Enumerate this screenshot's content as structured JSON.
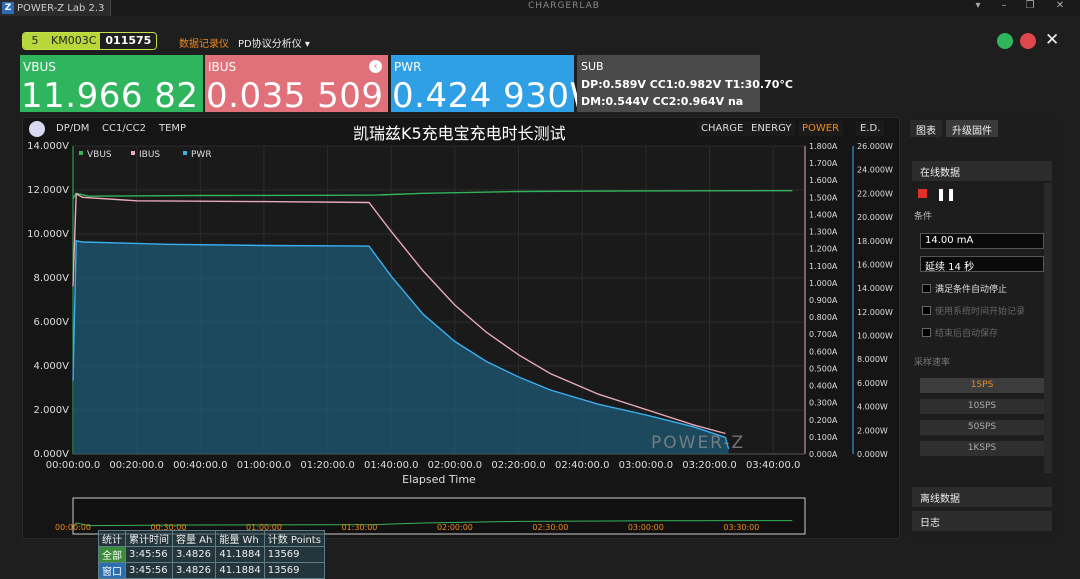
{
  "window": {
    "title": "POWER-Z Lab 2.3",
    "app_icon": "Z",
    "center_logo": "CHARGERLAB",
    "controls": [
      "menu-icon",
      "minimize-icon",
      "restore-icon",
      "close-icon"
    ]
  },
  "device": {
    "index": "5",
    "model": "KM003C",
    "serial": "011575"
  },
  "modes": {
    "recorder": "数据记录仪",
    "pd_analyzer": "PD协议分析仪"
  },
  "readouts": {
    "vbus": {
      "label": "VBUS",
      "value": "11.966 82 V",
      "color": "#2fb55d"
    },
    "ibus": {
      "label": "IBUS",
      "value": "0.035 509 A",
      "color": "#e0707a"
    },
    "pwr": {
      "label": "PWR",
      "value": "0.424 930W",
      "color": "#2f9fe6"
    },
    "sub": {
      "label": "SUB",
      "line1": "DP:0.589V  CC1:0.982V  T1:30.70°C",
      "line2": "DM:0.544V  CC2:0.964V  na"
    }
  },
  "chart_tabs_left": [
    "DP/DM",
    "CC1/CC2",
    "TEMP"
  ],
  "chart_tabs_right": [
    "CHARGE",
    "ENERGY",
    "POWER",
    "E.D."
  ],
  "chart_active_tab": "POWER",
  "chart_data": {
    "type": "line",
    "title": "凯瑞兹K5充电宝充电时长测试",
    "xlabel": "Elapsed Time",
    "x_ticks": [
      "00:00:00.0",
      "00:20:00.0",
      "00:40:00.0",
      "01:00:00.0",
      "01:20:00.0",
      "01:40:00.0",
      "02:00:00.0",
      "02:20:00.0",
      "02:40:00.0",
      "03:00:00.0",
      "03:20:00.0",
      "03:40:00.0"
    ],
    "x_unit": "minutes",
    "x_range": [
      0,
      230
    ],
    "legend": [
      "VBUS",
      "IBUS",
      "PWR"
    ],
    "legend_placement": "top-left",
    "axes": {
      "vbus": {
        "ticks": [
          "0.000V",
          "2.000V",
          "4.000V",
          "6.000V",
          "8.000V",
          "10.000V",
          "12.000V",
          "14.000V"
        ],
        "range": [
          0,
          14
        ]
      },
      "ibus": {
        "ticks": [
          "0.000A",
          "0.100A",
          "0.200A",
          "0.300A",
          "0.400A",
          "0.500A",
          "0.600A",
          "0.700A",
          "0.800A",
          "0.900A",
          "1.000A",
          "1.100A",
          "1.200A",
          "1.300A",
          "1.400A",
          "1.500A",
          "1.600A",
          "1.700A",
          "1.800A"
        ],
        "range": [
          0,
          1.8
        ]
      },
      "pwr": {
        "ticks": [
          "0.000W",
          "2.000W",
          "4.000W",
          "6.000W",
          "8.000W",
          "10.000W",
          "12.000W",
          "14.000W",
          "16.000W",
          "18.000W",
          "20.000W",
          "22.000W",
          "24.000W",
          "26.000W"
        ],
        "range": [
          0,
          26
        ]
      }
    },
    "series": [
      {
        "name": "VBUS",
        "color": "#35b35a",
        "x": [
          0,
          1,
          5,
          40,
          80,
          95,
          110,
          140,
          180,
          215,
          226
        ],
        "y": [
          11.6,
          11.85,
          11.72,
          11.75,
          11.76,
          11.77,
          11.85,
          11.93,
          11.96,
          11.97,
          11.97
        ]
      },
      {
        "name": "IBUS",
        "color": "#e8a9b8",
        "x": [
          0,
          1,
          3,
          20,
          60,
          93,
          100,
          110,
          120,
          130,
          140,
          150,
          165,
          180,
          195,
          205
        ],
        "y": [
          0.98,
          1.52,
          1.5,
          1.48,
          1.475,
          1.47,
          1.3,
          1.07,
          0.87,
          0.71,
          0.58,
          0.47,
          0.35,
          0.26,
          0.17,
          0.12
        ]
      },
      {
        "name": "PWR",
        "color": "#39aef0",
        "x": [
          0,
          1,
          3,
          30,
          60,
          93,
          100,
          110,
          120,
          130,
          140,
          150,
          165,
          180,
          195,
          205,
          206
        ],
        "y": [
          6.2,
          18.0,
          17.9,
          17.7,
          17.6,
          17.55,
          15.0,
          11.8,
          9.5,
          7.8,
          6.5,
          5.4,
          4.2,
          3.3,
          2.3,
          1.4,
          0.42
        ]
      }
    ],
    "grid": true,
    "watermark": "POWER-Z"
  },
  "overview": {
    "ticks": [
      "00:00:00",
      "00:30:00",
      "01:00:00",
      "01:30:00",
      "02:00:00",
      "02:30:00",
      "03:00:00",
      "03:30:00"
    ]
  },
  "stats": {
    "headers": [
      "统计",
      "累计时间",
      "容量 Ah",
      "能量 Wh",
      "计数 Points"
    ],
    "rows": [
      {
        "tag": "全部",
        "time": "3:45:56",
        "capacity": "3.4826",
        "energy": "41.1884",
        "points": "13569"
      },
      {
        "tag": "窗口",
        "time": "3:45:56",
        "capacity": "3.4826",
        "energy": "41.1884",
        "points": "13569"
      }
    ]
  },
  "side": {
    "tabs": [
      "图表",
      "升级固件"
    ],
    "online_data": "在线数据",
    "condition_label": "条件",
    "current_field": "14.00 mA",
    "duration_field": "延续 14 秒",
    "auto_stop": "满足条件自动停止",
    "use_system_time": "使用系统时间开始记录",
    "auto_save": "结束后自动保存",
    "rate_label": "采样速率",
    "rates": [
      "1SPS",
      "10SPS",
      "50SPS",
      "1KSPS"
    ],
    "active_rate": "1SPS",
    "offline_data": "离线数据",
    "log": "日志"
  }
}
